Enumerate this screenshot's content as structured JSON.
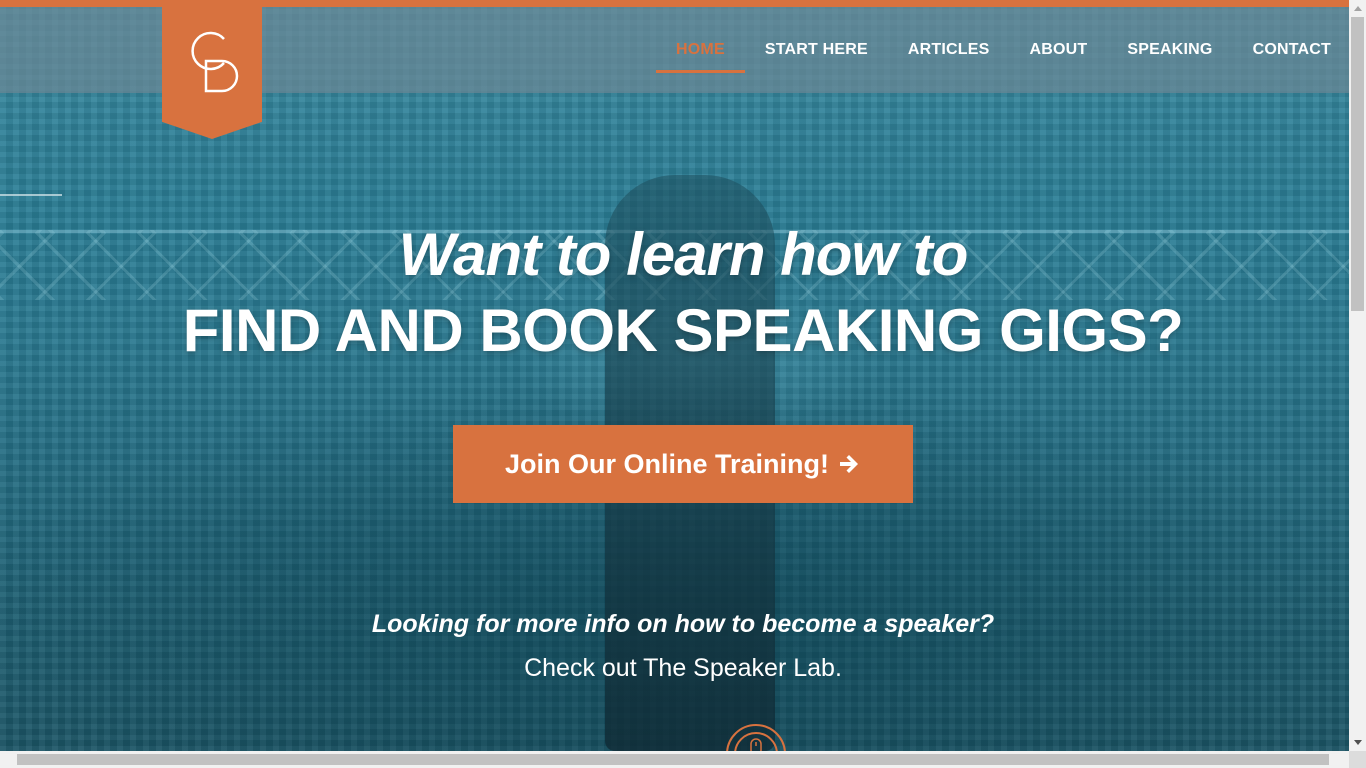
{
  "brand": {
    "logo_text": "CB",
    "accent": "#d8723f"
  },
  "nav": {
    "items": [
      {
        "label": "HOME",
        "active": true
      },
      {
        "label": "START HERE",
        "active": false
      },
      {
        "label": "ARTICLES",
        "active": false
      },
      {
        "label": "ABOUT",
        "active": false
      },
      {
        "label": "SPEAKING",
        "active": false
      },
      {
        "label": "CONTACT",
        "active": false
      }
    ]
  },
  "hero": {
    "headline_line1": "Want to learn how to",
    "headline_line2": "FIND AND BOOK SPEAKING GIGS?",
    "cta_label": "Join Our Online Training!",
    "cta_icon": "arrow-right-icon",
    "sub_question": "Looking for more info on how to become a speaker?",
    "sub_link": "Check out The Speaker Lab."
  },
  "colors": {
    "overlay_teal": "#2a7d95",
    "header_bar": "#69879480",
    "button_orange": "#d8723f"
  }
}
